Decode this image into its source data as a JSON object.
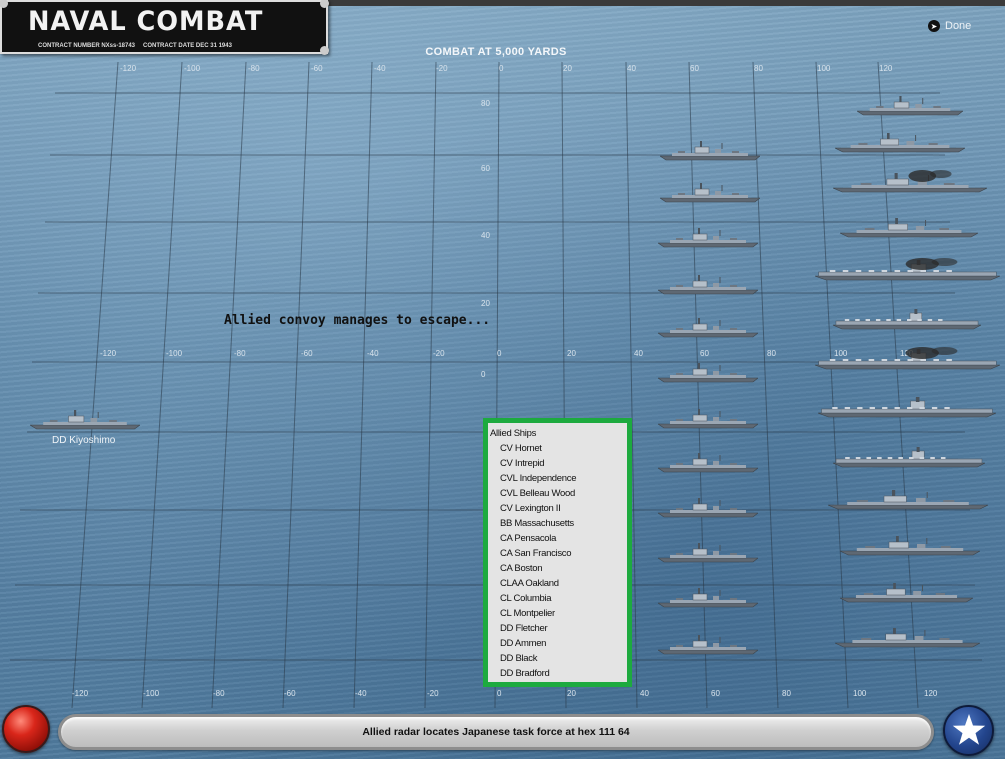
{
  "header": {
    "logo_title": "NAVAL COMBAT",
    "logo_contract_number": "CONTRACT NUMBER NXss-18743",
    "logo_contract_date": "CONTRACT DATE DEC 31 1943",
    "done_label": "Done",
    "combat_title": "COMBAT AT 5,000 YARDS"
  },
  "grid": {
    "top_ticks": [
      "-120",
      "-100",
      "-80",
      "-60",
      "-40",
      "-20",
      "0",
      "20",
      "40",
      "60",
      "80",
      "100",
      "120"
    ],
    "mid_ticks": [
      "-120",
      "-100",
      "-80",
      "-60",
      "-40",
      "-20",
      "0",
      "20",
      "40",
      "60",
      "80",
      "100",
      "120"
    ],
    "bottom_ticks": [
      "-120",
      "-100",
      "-80",
      "-60",
      "-40",
      "-20",
      "0",
      "20",
      "40",
      "60",
      "80",
      "100",
      "120"
    ],
    "left_ticks": [
      "80",
      "60",
      "40",
      "20",
      "0"
    ]
  },
  "message": "Allied convoy manages to escape...",
  "enemy_ship": {
    "label": "DD Kiyoshimo"
  },
  "ship_list": {
    "header": "Allied Ships",
    "items": [
      "CV Hornet",
      "CV Intrepid",
      "CVL Independence",
      "CVL Belleau Wood",
      "CV Lexington II",
      "BB Massachusetts",
      "CA Pensacola",
      "CA San Francisco",
      "CA Boston",
      "CLAA Oakland",
      "CL Columbia",
      "CL Montpelier",
      "DD Fletcher",
      "DD Ammen",
      "DD Black",
      "DD Bradford"
    ],
    "border_color": "#1daa3f"
  },
  "status_bar": {
    "text": "Allied radar locates Japanese task force at hex 111 64"
  },
  "colors": {
    "sea": "#5f89ab",
    "ship_hull": "#9aa6b3",
    "smoke": "#2a2a2a"
  }
}
